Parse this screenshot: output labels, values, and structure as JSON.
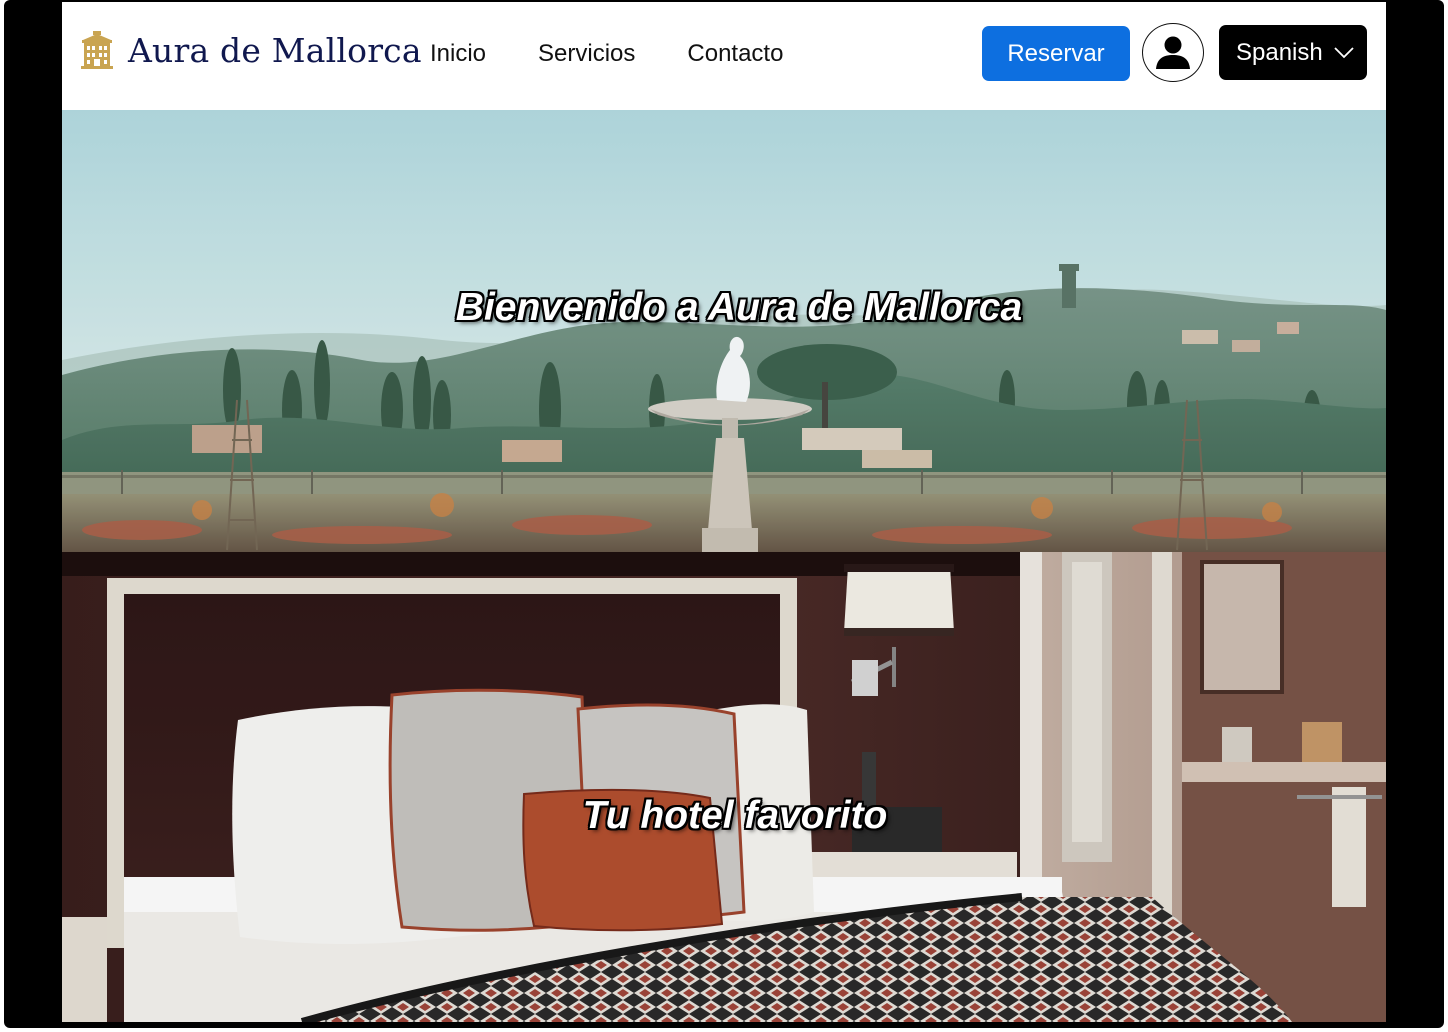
{
  "brand": {
    "name": "Aura de Mallorca",
    "icon": "hotel-building-icon",
    "color": "#10184e",
    "icon_color": "#c9a451"
  },
  "nav": {
    "items": [
      {
        "label": "Inicio"
      },
      {
        "label": "Servicios"
      },
      {
        "label": "Contacto"
      }
    ]
  },
  "actions": {
    "reserve_label": "Reservar",
    "reserve_color": "#0d6fe0",
    "user_icon": "user-account-icon",
    "language": {
      "selected": "Spanish",
      "icon": "chevron-down-icon"
    }
  },
  "hero": {
    "welcome_title": "Bienvenido a Aura de Mallorca",
    "welcome_image": "garden-terrace-fountain-hillside-photo",
    "room_title": "Tu hotel favorito",
    "room_image": "hotel-bedroom-bed-pillows-photo"
  }
}
